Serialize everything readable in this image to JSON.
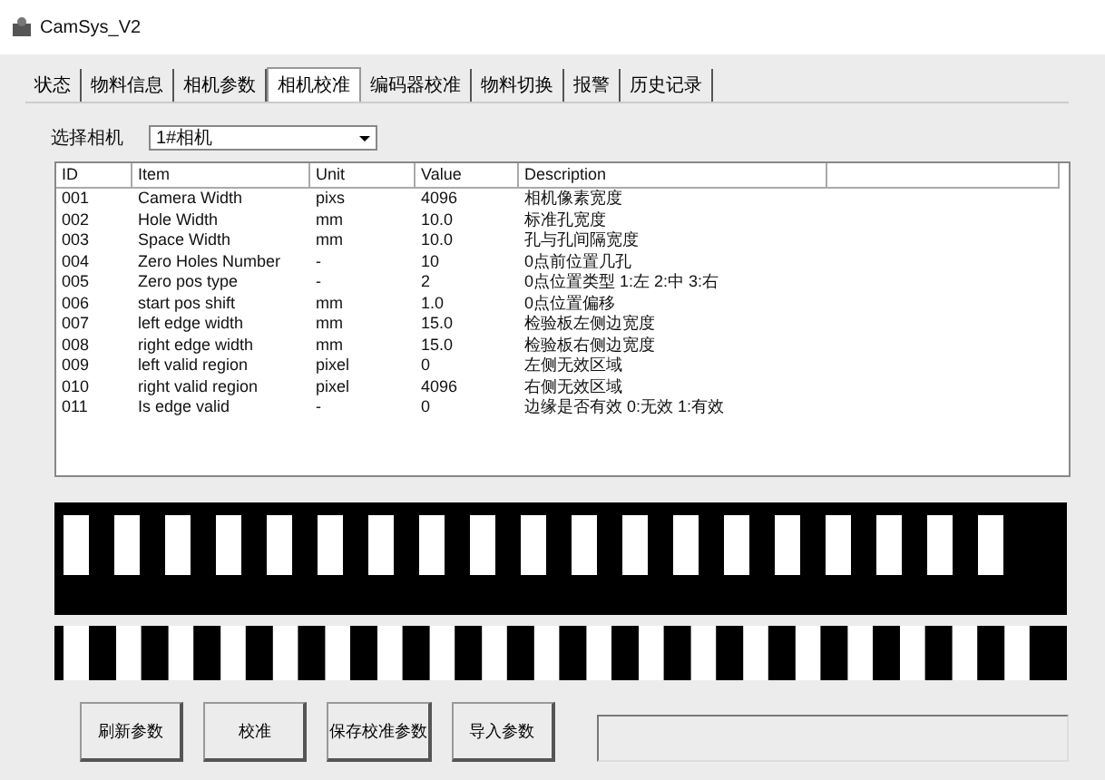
{
  "window": {
    "title": "CamSys_V2"
  },
  "tabs": [
    {
      "label": "状态",
      "selected": false
    },
    {
      "label": "物料信息",
      "selected": false
    },
    {
      "label": "相机参数",
      "selected": false
    },
    {
      "label": "相机校准",
      "selected": true
    },
    {
      "label": "编码器校准",
      "selected": false
    },
    {
      "label": "物料切换",
      "selected": false
    },
    {
      "label": "报警",
      "selected": false
    },
    {
      "label": "历史记录",
      "selected": false
    }
  ],
  "camera_select": {
    "label": "选择相机",
    "value": "1#相机"
  },
  "table": {
    "columns": [
      "ID",
      "Item",
      "Unit",
      "Value",
      "Description"
    ],
    "rows": [
      [
        "001",
        "Camera Width",
        "pixs",
        "4096",
        "相机像素宽度"
      ],
      [
        "002",
        "Hole Width",
        "mm",
        "10.0",
        "标准孔宽度"
      ],
      [
        "003",
        "Space Width",
        "mm",
        "10.0",
        "孔与孔间隔宽度"
      ],
      [
        "004",
        "Zero Holes Number",
        "-",
        "10",
        "0点前位置几孔"
      ],
      [
        "005",
        "Zero pos type",
        "-",
        "2",
        "0点位置类型 1:左 2:中 3:右"
      ],
      [
        "006",
        "start pos shift",
        "mm",
        "1.0",
        "0点位置偏移"
      ],
      [
        "007",
        "left edge width",
        "mm",
        "15.0",
        "检验板左侧边宽度"
      ],
      [
        "008",
        "right edge width",
        "mm",
        "15.0",
        "检验板右侧边宽度"
      ],
      [
        "009",
        "left valid region",
        "pixel",
        "0",
        "左侧无效区域"
      ],
      [
        "010",
        "right valid region",
        "pixel",
        "4096",
        "右侧无效区域"
      ],
      [
        "011",
        "Is edge valid",
        "-",
        "0",
        "边缘是否有效 0:无效 1:有效"
      ]
    ]
  },
  "buttons": [
    "刷新参数",
    "校准",
    "保存校准参数",
    "导入参数"
  ]
}
